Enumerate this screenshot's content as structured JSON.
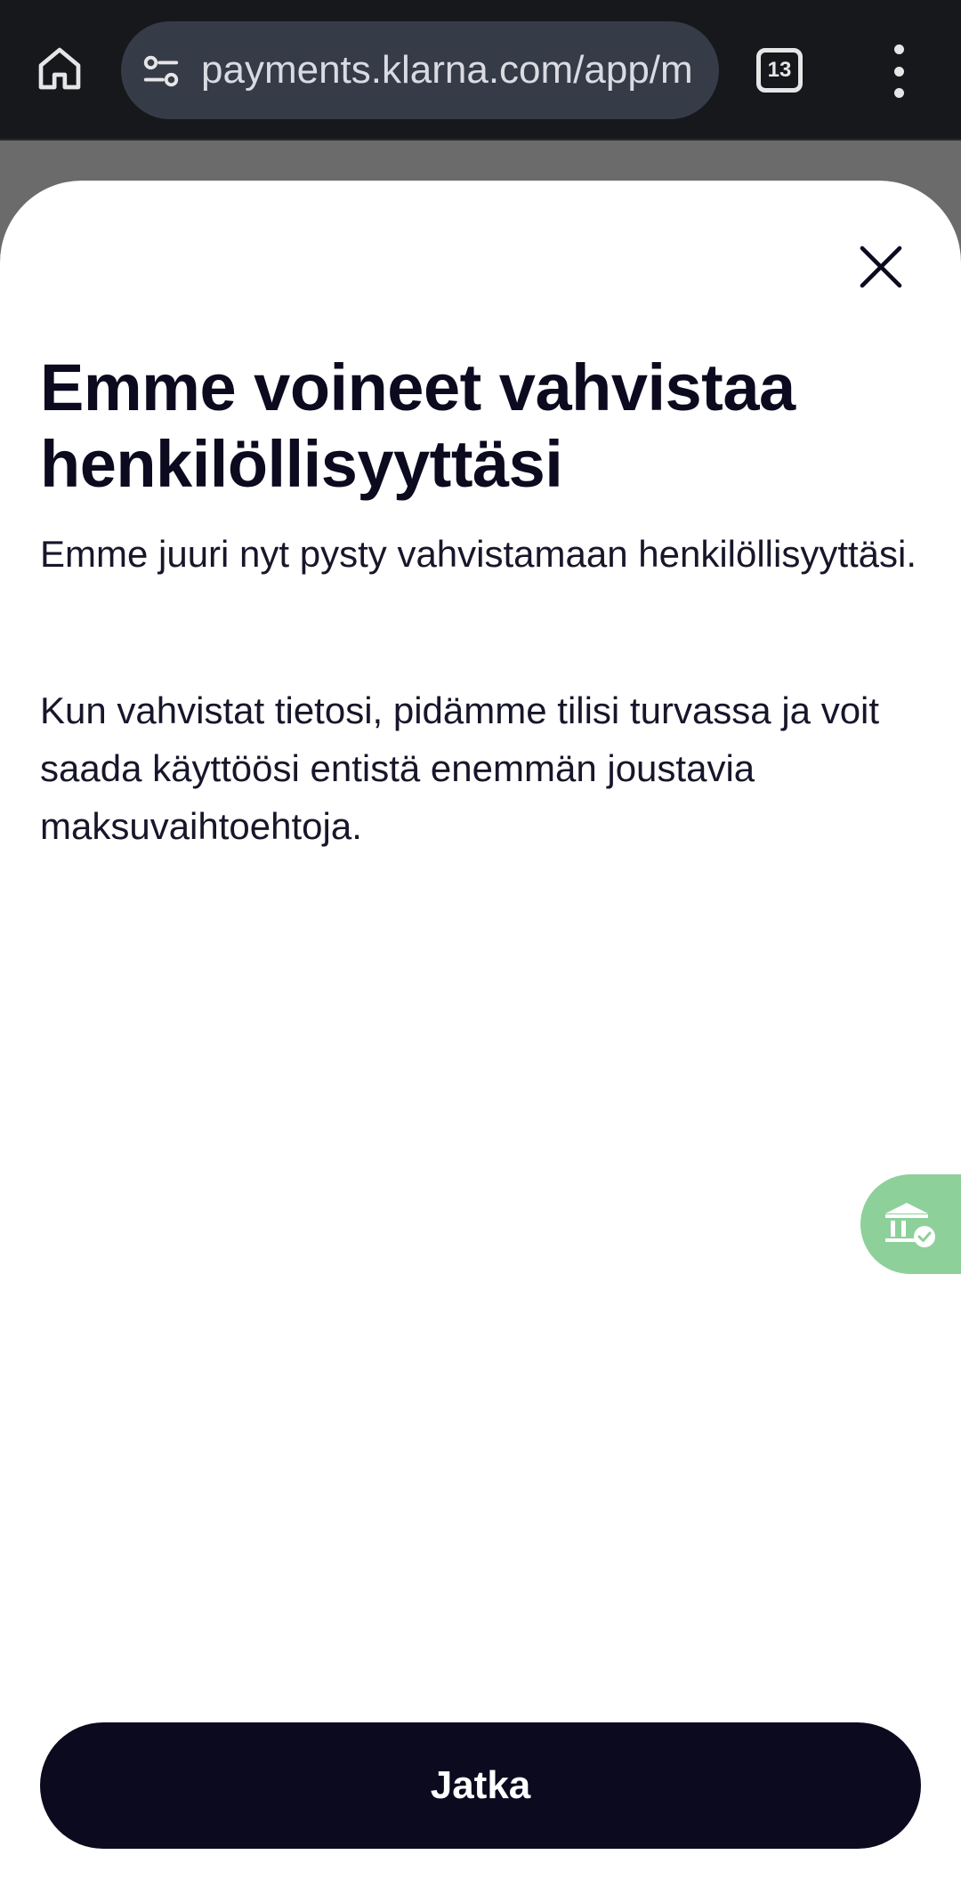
{
  "browser": {
    "url": "payments.klarna.com/app/m",
    "tab_count": "13",
    "icons": {
      "home": "home-icon",
      "site_settings": "tune-icon",
      "menu": "more-vert-icon"
    },
    "colors": {
      "bar_bg": "#17181b",
      "url_pill_bg": "#363b48"
    }
  },
  "dialog": {
    "title": "Emme voineet vahvistaa henkilöllisyyttäsi",
    "paragraph_1": "Emme juuri nyt pysty vahvistamaan henkilöllisyyttäsi.",
    "paragraph_2": "Kun vahvistat tietosi, pidämme tilisi turvassa ja voit saada käyttöösi entistä enemmän joustavia maksuvaihtoehtoja.",
    "close_icon": "close-icon",
    "continue_label": "Jatka",
    "side_badge_icon": "bank-verified-icon",
    "colors": {
      "text": "#0b0a1f",
      "button_bg": "#0b0a1f",
      "button_text": "#ffffff",
      "badge_bg": "#8ed09a"
    }
  }
}
